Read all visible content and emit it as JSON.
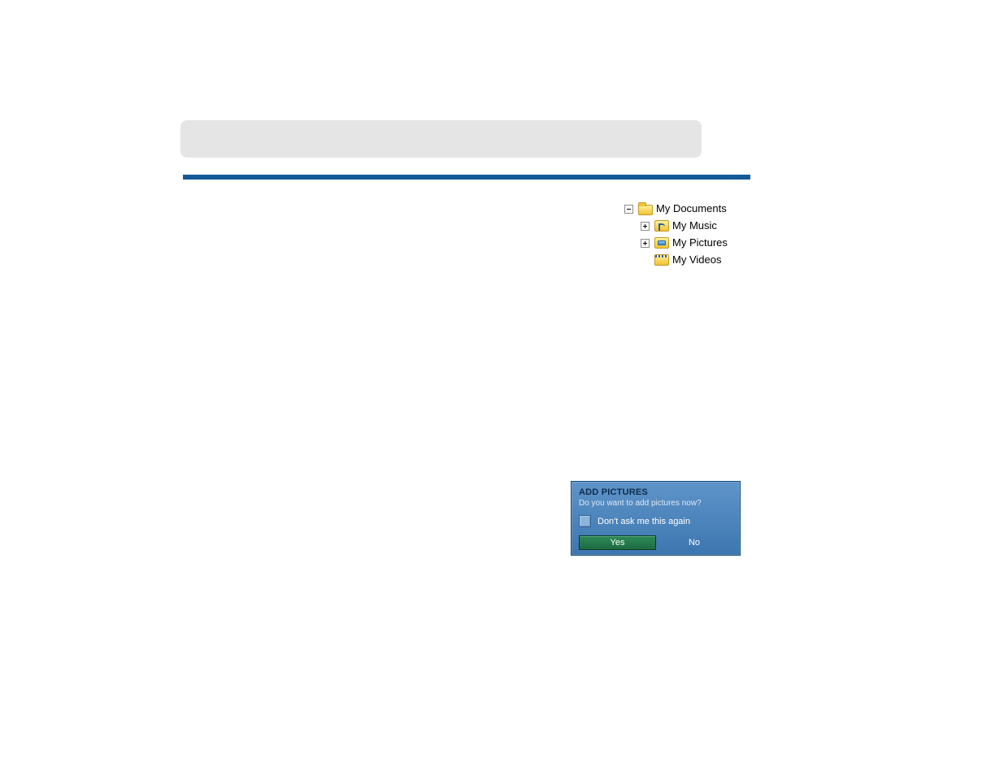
{
  "tree": {
    "root": {
      "label": "My Documents",
      "expanded": true,
      "icon": "folder-open-icon",
      "children": [
        {
          "label": "My Music",
          "expanded": false,
          "expandable": true,
          "icon": "music-folder-icon"
        },
        {
          "label": "My Pictures",
          "expanded": false,
          "expandable": true,
          "icon": "pictures-folder-icon"
        },
        {
          "label": "My Videos",
          "expanded": false,
          "expandable": false,
          "icon": "videos-folder-icon"
        }
      ]
    }
  },
  "dialog": {
    "title": "ADD PICTURES",
    "subtitle": "Do you want to add pictures now?",
    "checkbox_label": "Don't ask me this again",
    "yes_label": "Yes",
    "no_label": "No"
  }
}
